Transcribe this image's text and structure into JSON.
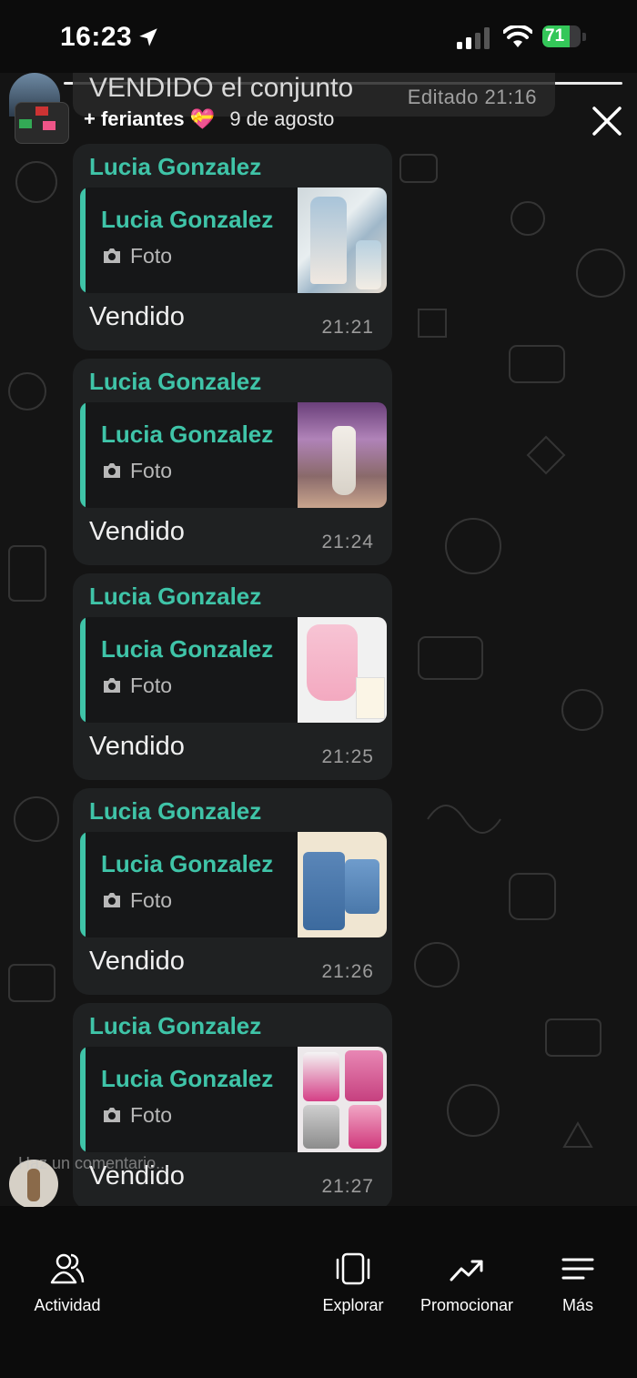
{
  "status_bar": {
    "time": "16:23",
    "battery": "71"
  },
  "story": {
    "header": {
      "title": "VENDIDO el conjunto",
      "edited": "Editado 21:16"
    },
    "group": {
      "name": "+ feriantes",
      "emoji": "💝",
      "date": "9 de agosto"
    },
    "messages": [
      {
        "sender": "Lucia Gonzalez",
        "quoted_sender": "Lucia Gonzalez",
        "quoted_type": "Foto",
        "text": "Vendido",
        "time": "21:21"
      },
      {
        "sender": "Lucia Gonzalez",
        "quoted_sender": "Lucia Gonzalez",
        "quoted_type": "Foto",
        "text": "Vendido",
        "time": "21:24"
      },
      {
        "sender": "Lucia Gonzalez",
        "quoted_sender": "Lucia Gonzalez",
        "quoted_type": "Foto",
        "text": "Vendido",
        "time": "21:25"
      },
      {
        "sender": "Lucia Gonzalez",
        "quoted_sender": "Lucia Gonzalez",
        "quoted_type": "Foto",
        "text": "Vendido",
        "time": "21:26"
      },
      {
        "sender": "Lucia Gonzalez",
        "quoted_sender": "Lucia Gonzalez",
        "quoted_type": "Foto",
        "text": "Vendido",
        "time": "21:27"
      }
    ],
    "comment_placeholder": "Haz un comentario..."
  },
  "bottom_nav": [
    {
      "label": "Actividad",
      "icon": "people-icon"
    },
    {
      "label": "Explorar",
      "icon": "explore-icon"
    },
    {
      "label": "Promocionar",
      "icon": "trending-icon"
    },
    {
      "label": "Más",
      "icon": "menu-icon"
    }
  ],
  "colors": {
    "accent": "#3fc4a8",
    "bubble": "#1f2122",
    "battery": "#34c759"
  }
}
